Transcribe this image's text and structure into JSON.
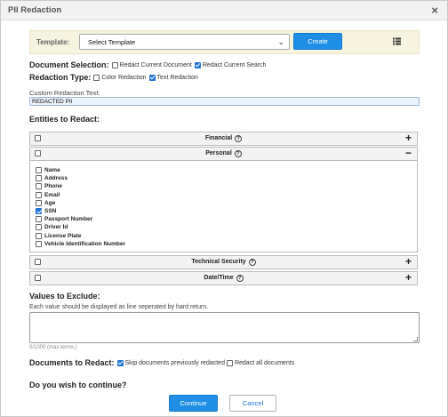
{
  "dialog": {
    "title": "PII Redaction",
    "close_glyph": "×"
  },
  "template": {
    "label": "Template:",
    "selected": "Select Template",
    "create_label": "Create",
    "list_icon": "list-icon"
  },
  "document_selection": {
    "label": "Document Selection:",
    "options": [
      {
        "label": "Redact Current Document",
        "checked": false
      },
      {
        "label": "Redact Current Search",
        "checked": true
      }
    ]
  },
  "redaction_type": {
    "label": "Redaction Type:",
    "options": [
      {
        "label": "Color Redaction",
        "checked": false
      },
      {
        "label": "Text Redaction",
        "checked": true
      }
    ]
  },
  "custom_text": {
    "label": "Custom Redaction Text:",
    "value": "REDACTED PII"
  },
  "entities": {
    "heading": "Entities to Redact:",
    "panels": [
      {
        "title": "Financial",
        "expanded": false,
        "toggle": "+"
      },
      {
        "title": "Personal",
        "expanded": true,
        "toggle": "−"
      },
      {
        "title": "Technical Security",
        "expanded": false,
        "toggle": "+"
      },
      {
        "title": "Date/Time",
        "expanded": false,
        "toggle": "+"
      }
    ],
    "personal_items": [
      {
        "label": "Name",
        "checked": false
      },
      {
        "label": "Address",
        "checked": false
      },
      {
        "label": "Phone",
        "checked": false
      },
      {
        "label": "Email",
        "checked": false
      },
      {
        "label": "Age",
        "checked": false
      },
      {
        "label": "SSN",
        "checked": true
      },
      {
        "label": "Passport Number",
        "checked": false
      },
      {
        "label": "Driver Id",
        "checked": false
      },
      {
        "label": "License Plate",
        "checked": false
      },
      {
        "label": "Vehicle Identification Number",
        "checked": false
      }
    ]
  },
  "exclude": {
    "heading": "Values to Exclude:",
    "description": "Each value should be displayed as line seperated by hard return.",
    "value": "",
    "counter": "0/1000 (max terms.)"
  },
  "documents_to_redact": {
    "label": "Documents to Redact:",
    "options": [
      {
        "label": "Skip documents previously redacted",
        "checked": true
      },
      {
        "label": "Redact all documents",
        "checked": false
      }
    ]
  },
  "confirm": {
    "question": "Do you wish to continue?",
    "continue_label": "Continue",
    "cancel_label": "Cancel"
  },
  "colors": {
    "primary": "#1f8fe6",
    "template_bar": "#f6f3df",
    "checkbox_checked": "#1f74d6"
  }
}
